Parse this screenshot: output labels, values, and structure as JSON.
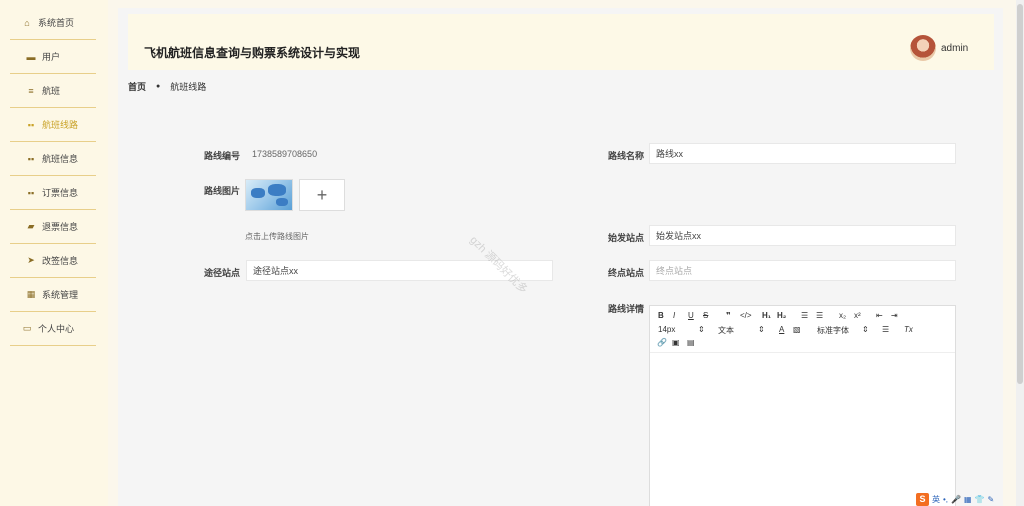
{
  "sidebar": {
    "items": [
      {
        "label": "系统首页",
        "icon": "home-icon"
      },
      {
        "label": "用户",
        "icon": "user-card-icon"
      },
      {
        "label": "航班",
        "icon": "menu-lines-icon"
      },
      {
        "label": "航班线路",
        "icon": "grid-icon",
        "active": true
      },
      {
        "label": "航班信息",
        "icon": "grid-icon"
      },
      {
        "label": "订票信息",
        "icon": "grid-icon"
      },
      {
        "label": "退票信息",
        "icon": "ticket-icon"
      },
      {
        "label": "改签信息",
        "icon": "send-icon"
      },
      {
        "label": "系统管理",
        "icon": "clipboard-icon"
      },
      {
        "label": "个人中心",
        "icon": "calendar-icon"
      }
    ]
  },
  "header": {
    "title": "飞机航班信息查询与购票系统设计与实现",
    "username": "admin"
  },
  "breadcrumb": {
    "home": "首页",
    "current": "航班线路"
  },
  "form": {
    "route_no_label": "路线编号",
    "route_no_value": "1738589708650",
    "route_name_label": "路线名称",
    "route_name_value": "路线xx",
    "route_image_label": "路线图片",
    "upload_plus": "+",
    "upload_hint": "点击上传路线图片",
    "start_station_label": "始发站点",
    "start_station_value": "始发站点xx",
    "via_station_label": "途径站点",
    "via_station_value": "途径站点xx",
    "end_station_label": "终点站点",
    "end_station_placeholder": "终点站点",
    "detail_label": "路线详情"
  },
  "editor_toolbar": {
    "bold": "B",
    "italic": "I",
    "underline": "U",
    "strike": "S",
    "quote": "❞",
    "code": "</>",
    "h1": "H₁",
    "h2": "H₂",
    "ordered_list": "☰",
    "bullet_list": "☰",
    "subscript": "x₂",
    "superscript": "x²",
    "outdent": "⇤",
    "indent": "⇥",
    "font_size": "14px",
    "text_type": "文本",
    "font_color": "A",
    "bg_color": "▧",
    "font_family": "标准字体",
    "align": "☰",
    "clear_format": "Tx",
    "link": "🔗",
    "image": "▣",
    "video": "▤"
  },
  "watermark": "gzh 源码好优多",
  "tray": {
    "ime_label": "英"
  }
}
